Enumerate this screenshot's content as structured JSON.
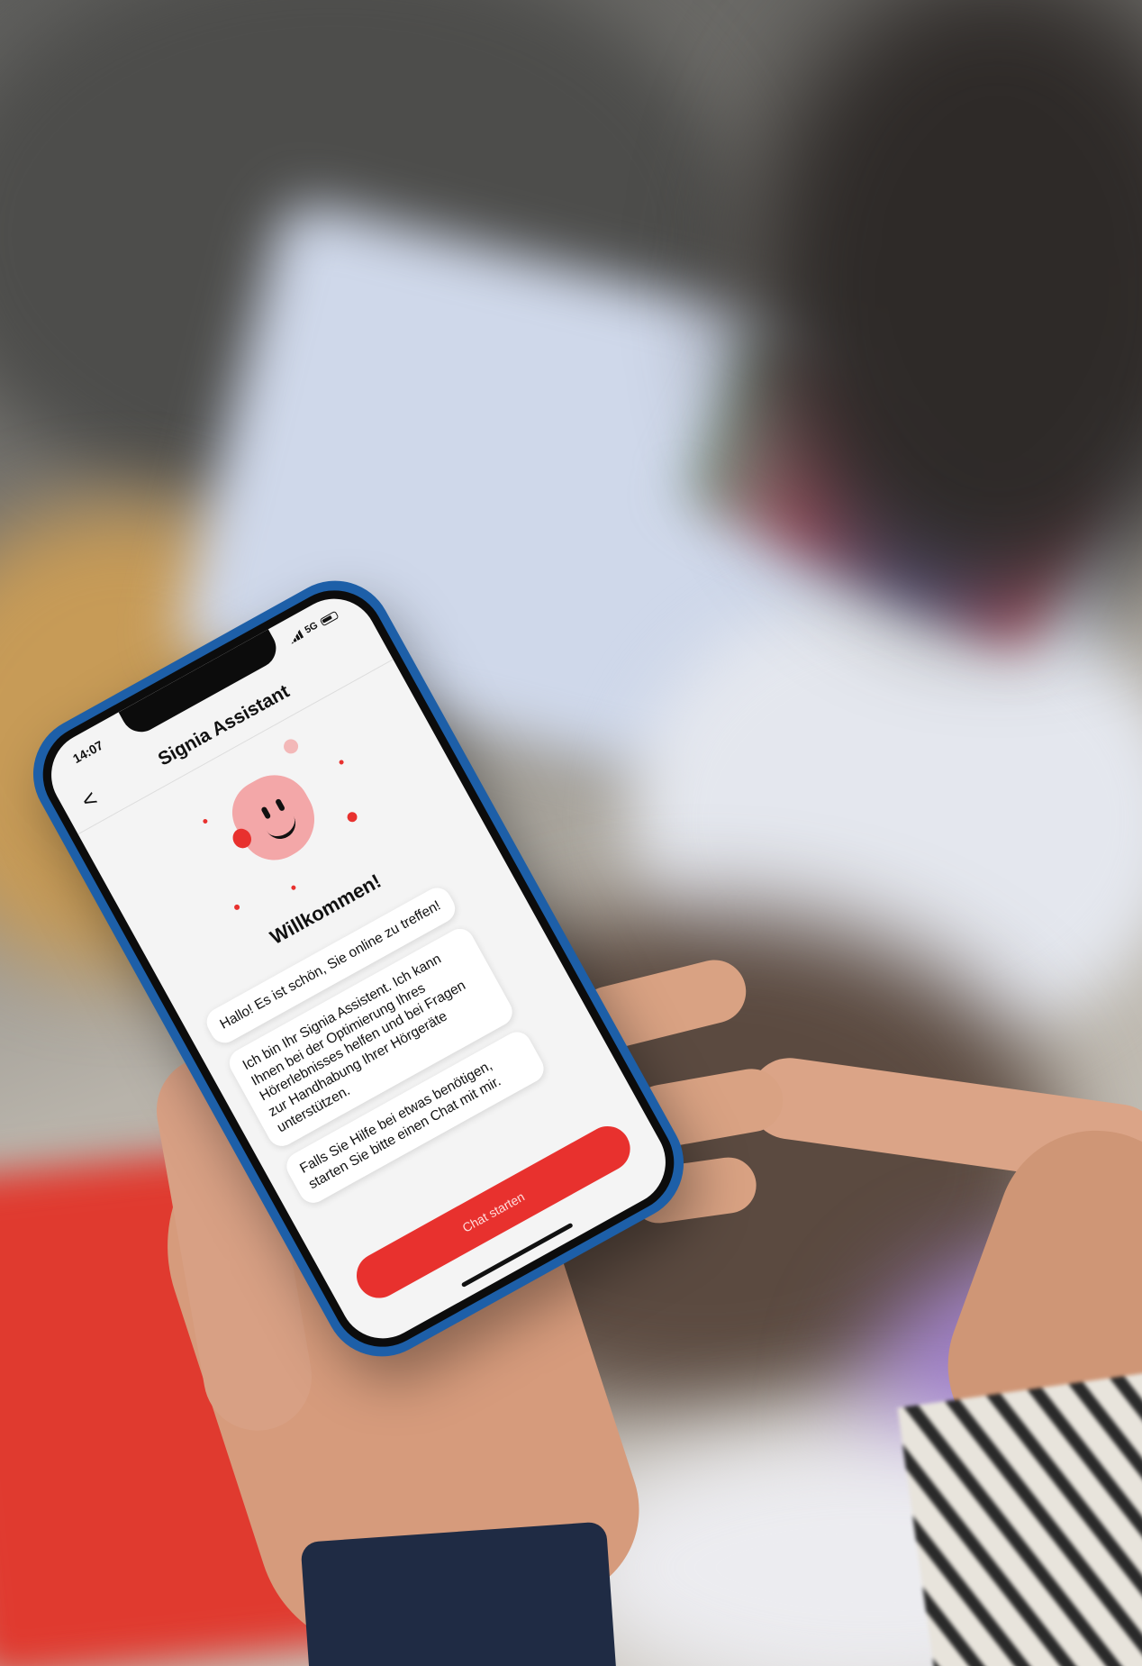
{
  "phone": {
    "status_time": "14:07",
    "status_network": "5G",
    "header": {
      "title": "Signia Assistant",
      "back_glyph": "<"
    },
    "welcome_title": "Willkommen!",
    "messages": [
      "Hallo! Es ist schön, Sie online zu treffen!",
      "Ich bin Ihr Signia Assistent. Ich kann Ihnen bei der Optimierung Ihres Hörerlebnisses helfen und bei Fragen zur Handhabung Ihrer Hörgeräte unterstützen.",
      "Falls Sie Hilfe bei etwas benötigen, starten Sie bitte einen Chat mit mir."
    ],
    "cta_label": "Chat starten",
    "accent_color": "#e8312e",
    "frame_color": "#1d5fa8",
    "icons": [
      "back-icon",
      "signal-icon",
      "battery-icon",
      "assistant-face-icon"
    ]
  }
}
